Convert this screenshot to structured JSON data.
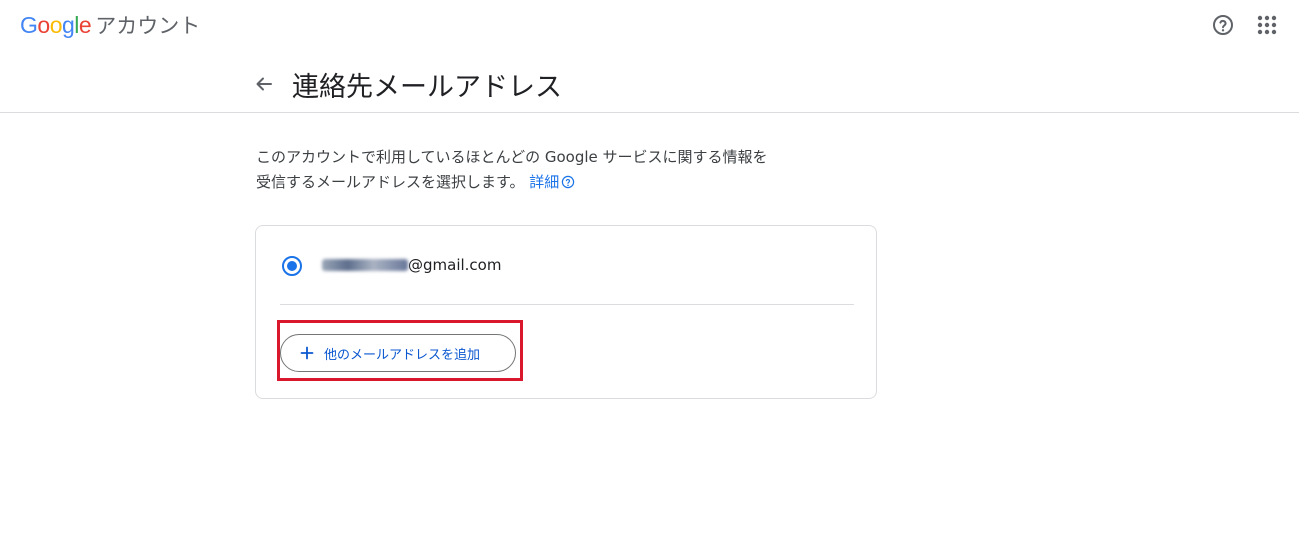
{
  "app": {
    "logo_letters": [
      "G",
      "o",
      "o",
      "g",
      "l",
      "e"
    ],
    "logo_colors": [
      "#4285F4",
      "#EA4335",
      "#FBBC05",
      "#4285F4",
      "#34A853",
      "#EA4335"
    ],
    "product_name": "アカウント"
  },
  "topbar": {
    "help_icon": "help-circle-icon",
    "apps_icon": "apps-grid-icon"
  },
  "header": {
    "back_icon": "arrow-back-icon",
    "title": "連絡先メールアドレス"
  },
  "description": {
    "line1": "このアカウントで利用しているほとんどの Google サービスに関する情報を",
    "line2": "受信するメールアドレスを選択します。",
    "learn_more": "詳細",
    "learn_more_icon": "help-outline-icon"
  },
  "emails": {
    "options": [
      {
        "address_suffix": "@gmail.com",
        "selected": true,
        "address_prefix_blurred": true
      }
    ]
  },
  "add_button": {
    "label": "他のメールアドレスを追加",
    "icon": "plus-icon"
  },
  "colors": {
    "accent": "#1a73e8",
    "button_text": "#0b57d0",
    "highlight_box": "#d9172d",
    "divider": "#dadce0"
  }
}
